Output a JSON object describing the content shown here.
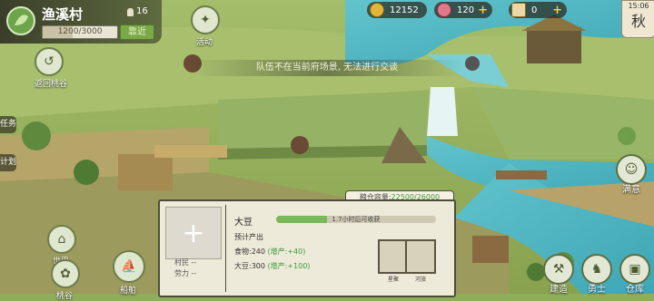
{
  "village": {
    "name": "渔溪村",
    "population": "16",
    "hp_text": "1200/3000",
    "hp_fraction": 0.4,
    "near_label": "靠近"
  },
  "left_nav": {
    "return_label": "返回桃谷",
    "task_label": "任务",
    "plan_label": "计划",
    "world_label": "世界",
    "peach_label": "桃谷",
    "ship_label": "船舶"
  },
  "top_nav": {
    "activity_label": "活动"
  },
  "resources": {
    "coins": "12152",
    "gems": "120",
    "tickets": "0"
  },
  "season": {
    "time": "15:06",
    "name": "秋"
  },
  "notice": "队伍不在当前府场景, 无法进行交谈",
  "info_panel": {
    "capacity_label": "粮仓容量:",
    "capacity_value": "22500/26000",
    "resource_name": "大豆",
    "progress_text": "1.7小时后可收获",
    "progress_fraction": 0.32,
    "expected_label": "预计产出",
    "food_label": "食物:240",
    "food_bonus": "(增产:+40)",
    "bean_label": "大豆:300",
    "bean_bonus": "(增产:+100)",
    "villager_label": "村民 --",
    "labor_label": "劳力 --",
    "card1_label": "星聚",
    "card2_label": "河旅"
  },
  "bottom_right": {
    "quest_label": "满意",
    "build_label": "建造",
    "hero_label": "勇士",
    "warehouse_label": "仓库"
  },
  "colors": {
    "water": "#4fb8c4",
    "grass": "#8fae5a",
    "cliff": "#9ab86a",
    "accent_green": "#7ab65a"
  }
}
